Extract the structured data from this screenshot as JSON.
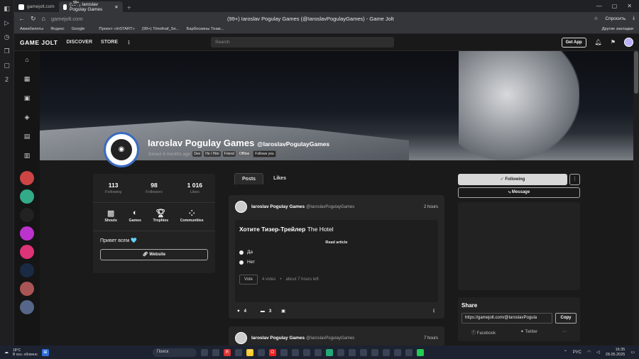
{
  "browser": {
    "tabs": [
      {
        "label": "gamejolt.com"
      },
      {
        "label": "(99+) Iaroslav Pogulay Games"
      }
    ],
    "badge": "99+",
    "url": "gamejolt.com",
    "window_title": "(99+) Iaroslav Pogulay Games (@IaroslavPogulayGames) - Game Jolt",
    "ask_label": "Спросить",
    "bookmarks": [
      "Авиабилеты",
      "Яндекс",
      "Google",
      "",
      "Проект «InSTART»",
      "(99+) Timofnaf_Se...",
      "Барбоскины Теам..."
    ],
    "other_bookmarks": "Другие закладки"
  },
  "header": {
    "logo": "GAME JOLT",
    "nav": [
      "DISCOVER",
      "STORE"
    ],
    "search_placeholder": "Search",
    "get_app": "Get App"
  },
  "profile": {
    "name": "Iaroslav Pogulay Games",
    "handle": "@IaroslavPogulayGames",
    "joined": "Joined 4 months ago",
    "tags": [
      "Dev",
      "He / Him",
      "Friend",
      "Offline",
      "Follows you"
    ],
    "stats": [
      {
        "value": "113",
        "label": "Following"
      },
      {
        "value": "98",
        "label": "Followers"
      },
      {
        "value": "1 016",
        "label": "Likes"
      }
    ],
    "links": [
      {
        "label": "Shouts",
        "icon": "shouts-icon"
      },
      {
        "label": "Games",
        "icon": "gamepad-icon"
      },
      {
        "label": "Trophies",
        "icon": "trophy-icon"
      },
      {
        "label": "Communities",
        "icon": "communities-icon"
      }
    ],
    "bio": "Привет всем 🩵",
    "website": "Website"
  },
  "feed": {
    "tabs": [
      "Posts",
      "Likes"
    ],
    "post1": {
      "author": "Iaroslav Pogulay Games",
      "handle": "@IaroslavPogulayGames",
      "time": "2 hours",
      "title_bold": "Хотите Тизер-Трейлер",
      "title_rest": "The Hotel",
      "read_article": "Read article",
      "options": [
        "Да",
        "Нет"
      ],
      "vote_btn": "Vote",
      "votes": "4 votes",
      "ago": "about 7 hours left",
      "likes": "4",
      "comments": "3"
    },
    "post2": {
      "author": "Iaroslav Pogulay Games",
      "handle": "@IaroslavPogulayGames",
      "time": "7 hours"
    }
  },
  "right": {
    "following": "Following",
    "message": "Message",
    "share_title": "Share",
    "share_url": "https://gamejolt.com/@IaroslavPogula",
    "copy": "Copy",
    "facebook": "Facebook",
    "twitter": "Twitter"
  },
  "taskbar": {
    "temp": "18°C",
    "weather": "В осн. облачно",
    "search": "Поиск",
    "lang": "РУС",
    "time": "16:35",
    "date": "28.05.2025"
  }
}
